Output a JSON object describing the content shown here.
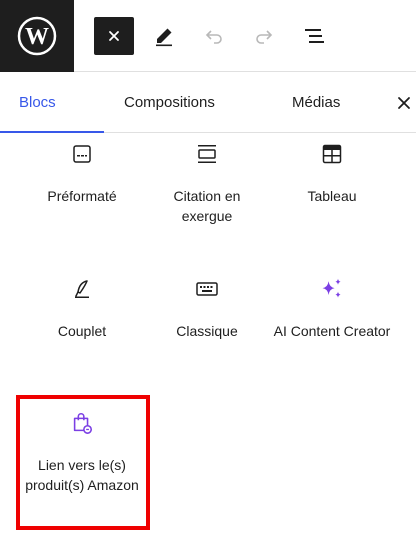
{
  "toolbar": {
    "logo": "wordpress-icon",
    "close_inserter": "close-icon",
    "tools": "pencil-icon",
    "undo": "undo-icon",
    "redo": "redo-icon",
    "outline": "list-view-icon"
  },
  "tabs": [
    {
      "label": "Blocs",
      "active": true
    },
    {
      "label": "Compositions",
      "active": false
    },
    {
      "label": "Médias",
      "active": false
    }
  ],
  "blocks": [
    {
      "label": "Préformaté",
      "icon": "preformatted-icon"
    },
    {
      "label": "Citation en exergue",
      "icon": "pullquote-icon"
    },
    {
      "label": "Tableau",
      "icon": "table-icon"
    },
    {
      "label": "Couplet",
      "icon": "verse-icon"
    },
    {
      "label": "Classique",
      "icon": "keyboard-icon"
    },
    {
      "label": "AI Content Creator",
      "icon": "sparkles-icon"
    },
    {
      "label": "Lien vers le(s) produit(s) Amazon",
      "icon": "shopping-bag-icon"
    }
  ],
  "colors": {
    "accent": "#3858e9",
    "ai_icon": "#7b3fe4",
    "highlight": "#ef0000",
    "dark": "#1e1e1e"
  }
}
